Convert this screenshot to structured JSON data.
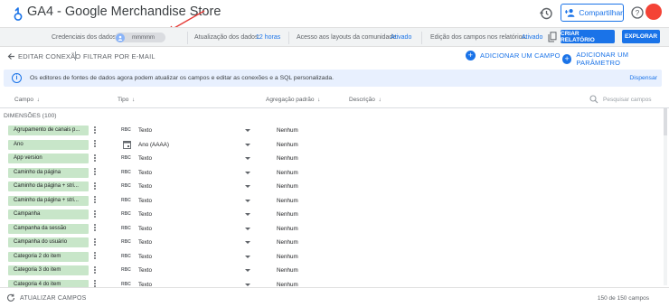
{
  "header": {
    "title": "GA4 - Google Merchandise Store",
    "share_label": "Compartilhar",
    "icons": [
      "logo-icon",
      "history-icon",
      "person-add-icon",
      "help-icon",
      "avatar"
    ],
    "avatar_color": "#f44336"
  },
  "settings": {
    "credentials_label": "Credenciais dos dados:",
    "credentials_value": "mmmmm",
    "refresh_label": "Atualização dos dados:",
    "refresh_value": "12 horas",
    "community_label": "Acesso aos layouts da comunidade:",
    "community_value": "Ativado",
    "edit_fields_label": "Edição dos campos nos relatórios:",
    "edit_fields_value": "Ativado",
    "create_report_label": "CRIAR RELATÓRIO",
    "explore_label": "EXPLORAR"
  },
  "toolbar": {
    "edit_connection": "EDITAR CONEXÃO",
    "filter_email": "FILTRAR POR E-MAIL",
    "add_field": "ADICIONAR UM CAMPO",
    "add_parameter": "ADICIONAR UM PARÂMETRO"
  },
  "banner": {
    "message": "Os editores de fontes de dados agora podem atualizar os campos e editar as conexões e a SQL personalizada.",
    "dismiss": "Dispensar"
  },
  "columns": {
    "field": "Campo",
    "type": "Tipo",
    "aggregation": "Agregação padrão",
    "description": "Descrição",
    "search_placeholder": "Pesquisar campos"
  },
  "section_title": "DIMENSÕES (100)",
  "rows": [
    {
      "name": "Agrupamento de canais p...",
      "type_icon": "RBC",
      "type": "Texto",
      "agg": "Nenhum"
    },
    {
      "name": "Ano",
      "type_icon": "calendar-icon",
      "type": "Ano (AAAA)",
      "agg": "Nenhum"
    },
    {
      "name": "App version",
      "type_icon": "RBC",
      "type": "Texto",
      "agg": "Nenhum"
    },
    {
      "name": "Caminho da página",
      "type_icon": "RBC",
      "type": "Texto",
      "agg": "Nenhum"
    },
    {
      "name": "Caminho da página + stri...",
      "type_icon": "RBC",
      "type": "Texto",
      "agg": "Nenhum"
    },
    {
      "name": "Caminho da página + stri...",
      "type_icon": "RBC",
      "type": "Texto",
      "agg": "Nenhum"
    },
    {
      "name": "Campanha",
      "type_icon": "RBC",
      "type": "Texto",
      "agg": "Nenhum"
    },
    {
      "name": "Campanha da sessão",
      "type_icon": "RBC",
      "type": "Texto",
      "agg": "Nenhum"
    },
    {
      "name": "Campanha do usuário",
      "type_icon": "RBC",
      "type": "Texto",
      "agg": "Nenhum"
    },
    {
      "name": "Categoria 2 do item",
      "type_icon": "RBC",
      "type": "Texto",
      "agg": "Nenhum"
    },
    {
      "name": "Categoria 3 do item",
      "type_icon": "RBC",
      "type": "Texto",
      "agg": "Nenhum"
    },
    {
      "name": "Categoria 4 do item",
      "type_icon": "RBC",
      "type": "Texto",
      "agg": "Nenhum"
    }
  ],
  "footer": {
    "refresh_label": "ATUALIZAR CAMPOS",
    "count": "150 de 150 campos"
  },
  "colors": {
    "accent": "#1a73e8",
    "chip": "#c8e6c9",
    "banner": "#e8f0fe",
    "annotation_arrow": "#e53935"
  }
}
